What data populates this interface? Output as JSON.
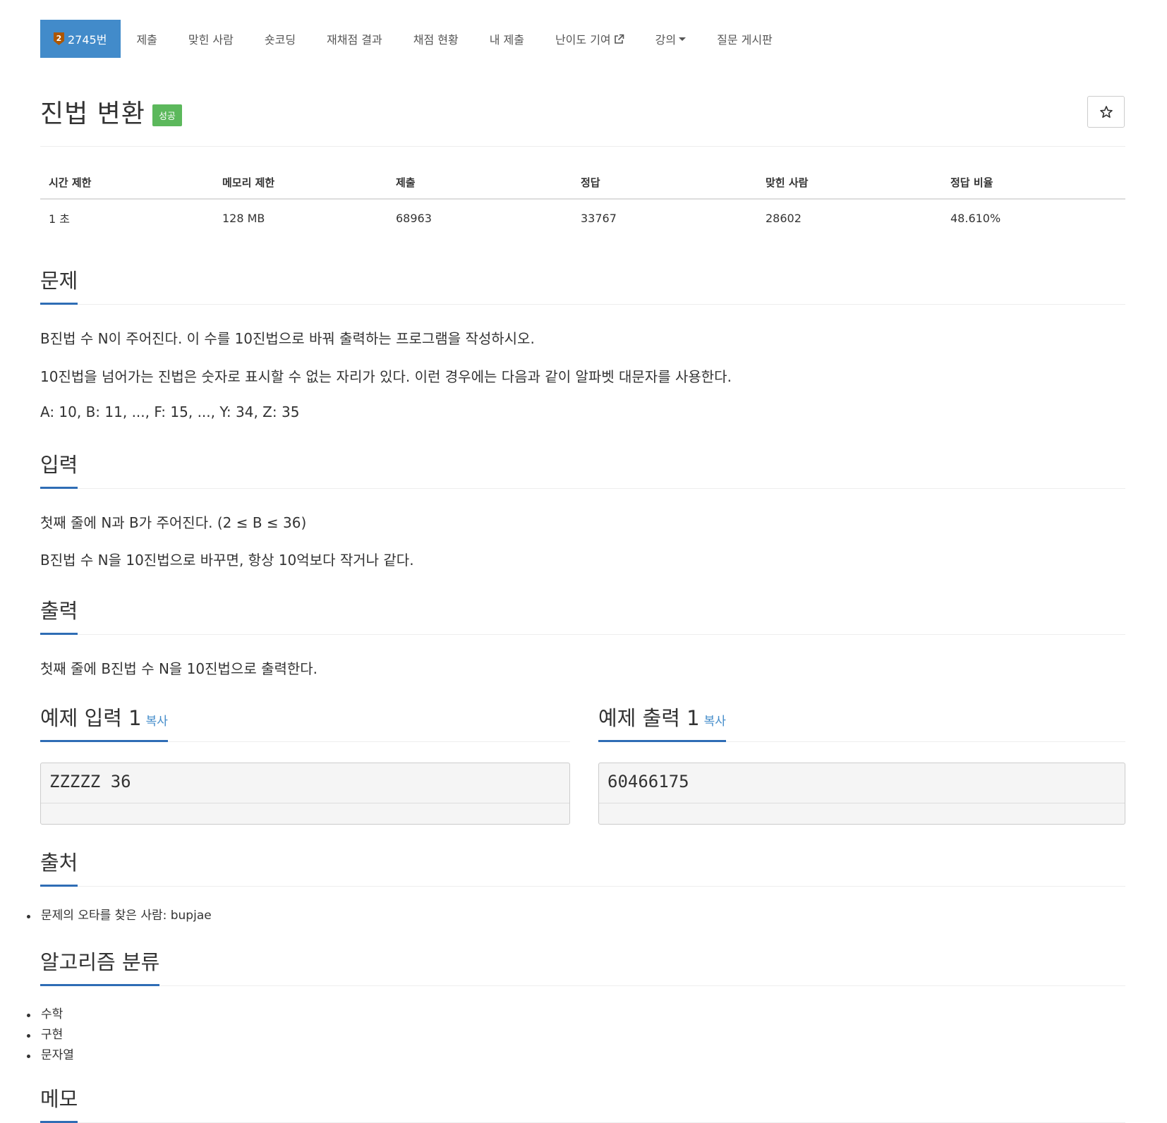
{
  "nav": {
    "problem_tab": "2745번",
    "tier": "2",
    "items": [
      "제출",
      "맞힌 사람",
      "숏코딩",
      "재채점 결과",
      "채점 현황",
      "내 제출",
      "난이도 기여",
      "강의",
      "질문 게시판"
    ]
  },
  "title": "진법 변환",
  "result_badge": "성공",
  "info": {
    "headers": [
      "시간 제한",
      "메모리 제한",
      "제출",
      "정답",
      "맞힌 사람",
      "정답 비율"
    ],
    "values": [
      "1 초",
      "128 MB",
      "68963",
      "33767",
      "28602",
      "48.610%"
    ]
  },
  "sections": {
    "problem": {
      "heading": "문제",
      "lines": [
        "B진법 수 N이 주어진다. 이 수를 10진법으로 바꿔 출력하는 프로그램을 작성하시오.",
        "10진법을 넘어가는 진법은 숫자로 표시할 수 없는 자리가 있다. 이런 경우에는 다음과 같이 알파벳 대문자를 사용한다.",
        "A: 10, B: 11, ..., F: 15, ..., Y: 34, Z: 35"
      ]
    },
    "input": {
      "heading": "입력",
      "lines": [
        "첫째 줄에 N과 B가 주어진다. (2 ≤ B ≤ 36)",
        "B진법 수 N을 10진법으로 바꾸면, 항상 10억보다 작거나 같다."
      ]
    },
    "output": {
      "heading": "출력",
      "lines": [
        "첫째 줄에 B진법 수 N을 10진법으로 출력한다."
      ]
    },
    "sample_input": {
      "heading": "예제 입력 1",
      "copy": "복사",
      "content": "ZZZZZ 36"
    },
    "sample_output": {
      "heading": "예제 출력 1",
      "copy": "복사",
      "content": "60466175"
    },
    "source": {
      "heading": "출처",
      "items": [
        "문제의 오타를 찾은 사람: bupjae"
      ]
    },
    "algorithm": {
      "heading": "알고리즘 분류",
      "items": [
        "수학",
        "구현",
        "문자열"
      ]
    },
    "memo": {
      "heading": "메모"
    }
  },
  "colors": {
    "nav_active": "#428bca",
    "success": "#5cb85c",
    "link": "#428bca",
    "section_underline": "#2f6db5",
    "tier_bronze": "#ad5600"
  },
  "icons": {
    "tier": "bronze-tier-icon",
    "external": "external-link-icon",
    "star": "star-outline-icon"
  }
}
